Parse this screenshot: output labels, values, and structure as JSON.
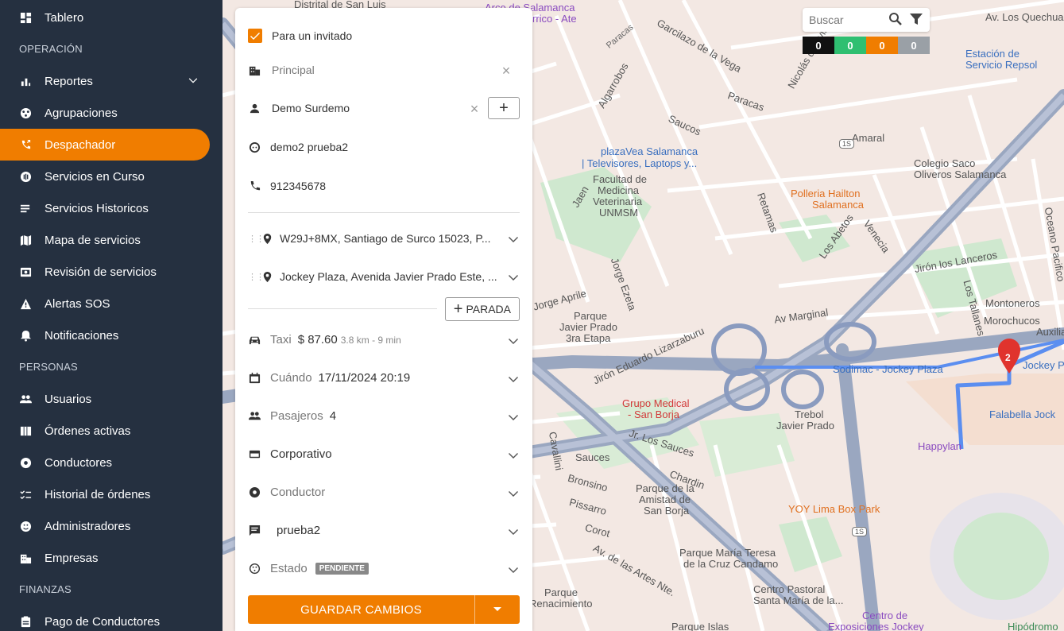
{
  "sidebar": {
    "items": [
      {
        "label": "Tablero",
        "icon": "dashboard-icon"
      },
      {
        "label": "Reportes",
        "icon": "bar-chart-icon"
      },
      {
        "label": "Agrupaciones",
        "icon": "group-icon"
      },
      {
        "label": "Despachador",
        "icon": "phone-forward-icon"
      },
      {
        "label": "Servicios en Curso",
        "icon": "in-progress-icon"
      },
      {
        "label": "Servicios Historicos",
        "icon": "list-icon"
      },
      {
        "label": "Mapa de servicios",
        "icon": "map-icon"
      },
      {
        "label": "Revisión de servicios",
        "icon": "review-icon"
      },
      {
        "label": "Alertas SOS",
        "icon": "warning-icon"
      },
      {
        "label": "Notificaciones",
        "icon": "bell-icon"
      },
      {
        "label": "Usuarios",
        "icon": "users-icon"
      },
      {
        "label": "Órdenes activas",
        "icon": "orders-icon"
      },
      {
        "label": "Conductores",
        "icon": "driver-icon"
      },
      {
        "label": "Historial de órdenes",
        "icon": "checklist-icon"
      },
      {
        "label": "Administradores",
        "icon": "admin-icon"
      },
      {
        "label": "Empresas",
        "icon": "building-icon"
      },
      {
        "label": "Pago de Conductores",
        "icon": "payment-icon"
      }
    ],
    "sections": {
      "operacion": "OPERACIÓN",
      "personas": "PERSONAS",
      "finanzas": "FINANZAS"
    }
  },
  "map": {
    "search_placeholder": "Buscar",
    "counters": [
      {
        "value": "0",
        "color": "#111111"
      },
      {
        "value": "0",
        "color": "#2fbf71"
      },
      {
        "value": "0",
        "color": "#f07d00"
      },
      {
        "value": "0",
        "color": "#9aa0a6"
      }
    ],
    "labels": {
      "l1": "Distrital de San Luis",
      "l2": "Arco de Salamanca",
      "l3": "rrico - Ate",
      "l4": "Av. Los Quechuas",
      "l5": "Estación de",
      "l6": "Servicio Repsol",
      "l7": "Paracas",
      "l8": "Garcilazo de la Vega",
      "l9": "Nicolás de Ayllón",
      "l10": "Paracas",
      "l11": "Algarrobos",
      "l12": "Saucos",
      "l13": "Amaral",
      "l14": "plazaVea Salamanca",
      "l15": "| Televisores, Laptops y...",
      "l16": "Colegio Saco",
      "l17": "Oliveros Salamanca",
      "l18": "Facultad de",
      "l19": "Medicina",
      "l20": "Veterinaria",
      "l21": "UNMSM",
      "l22": "Polleria Hailton",
      "l23": "Salamanca",
      "l24": "Jaen",
      "l25": "Retamas",
      "l26": "Los Abetos",
      "l27": "Venecia",
      "l28": "Jirón los Lanceros",
      "l29": "Jorge Aprile",
      "l30": "Jorge Ezeta",
      "l31": "Parque",
      "l32": "Javier Prado",
      "l33": "3ra Etapa",
      "l34": "Av Marginal",
      "l35": "Montoneros",
      "l36": "Morochucos",
      "l37": "Jirón Eduardo Lizarzaburu",
      "l38": "Sodimac - Jockey Plaza",
      "l39": "Jockey P",
      "l40": "Grupo Medical",
      "l41": "- San Borja",
      "l42": "Trebol",
      "l43": "Javier Prado",
      "l44": "Falabella Jock",
      "l45": "Happylan",
      "l46": "Jr. Los Sauces",
      "l47": "Sauces",
      "l48": "Bronsino",
      "l49": "Parque de la",
      "l50": "Amistad de",
      "l51": "San Borja",
      "l52": "Chardin",
      "l53": "YOY Lima Box Park",
      "l54": "Pissarro",
      "l55": "Corot",
      "l56": "Parque María Teresa",
      "l57": "de la Cruz Candamo",
      "l58": "Av. de las Artes Nte.",
      "l59": "Centro Pastoral",
      "l60": "Santa María de la...",
      "l61": "Parque",
      "l62": "Renacimiento",
      "l63": "Centro de",
      "l64": "Exposiciones Jockey",
      "l65": "Hipódromo",
      "l66": "Cavallini",
      "l67": "Oceano Pacifico",
      "l68": "Los Tallanes",
      "l69": "Auxiliar",
      "l70": "Parque Islas",
      "l71": "2",
      "l72": "1S",
      "l73": "1S"
    }
  },
  "panel": {
    "guest_label": "Para un invitado",
    "company": "Principal",
    "user": "Demo Surdemo",
    "guest_name": "demo2 prueba2",
    "phone": "912345678",
    "origin": "W29J+8MX, Santiago de Surco 15023, P...",
    "destination": "Jockey Plaza, Avenida Javier Prado Este, ...",
    "add_stop": "PARADA",
    "service_label": "Taxi",
    "price": "$ 87.60",
    "distance": "3.8 km - 9 min",
    "when_label": "Cuándo",
    "when_value": "17/11/2024 20:19",
    "passengers_label": "Pasajeros",
    "passengers_value": "4",
    "payment": "Corporativo",
    "driver_label": "Conductor",
    "note": "prueba2",
    "status_label": "Estado",
    "status_badge": "PENDIENTE",
    "save_label": "GUARDAR CAMBIOS"
  }
}
